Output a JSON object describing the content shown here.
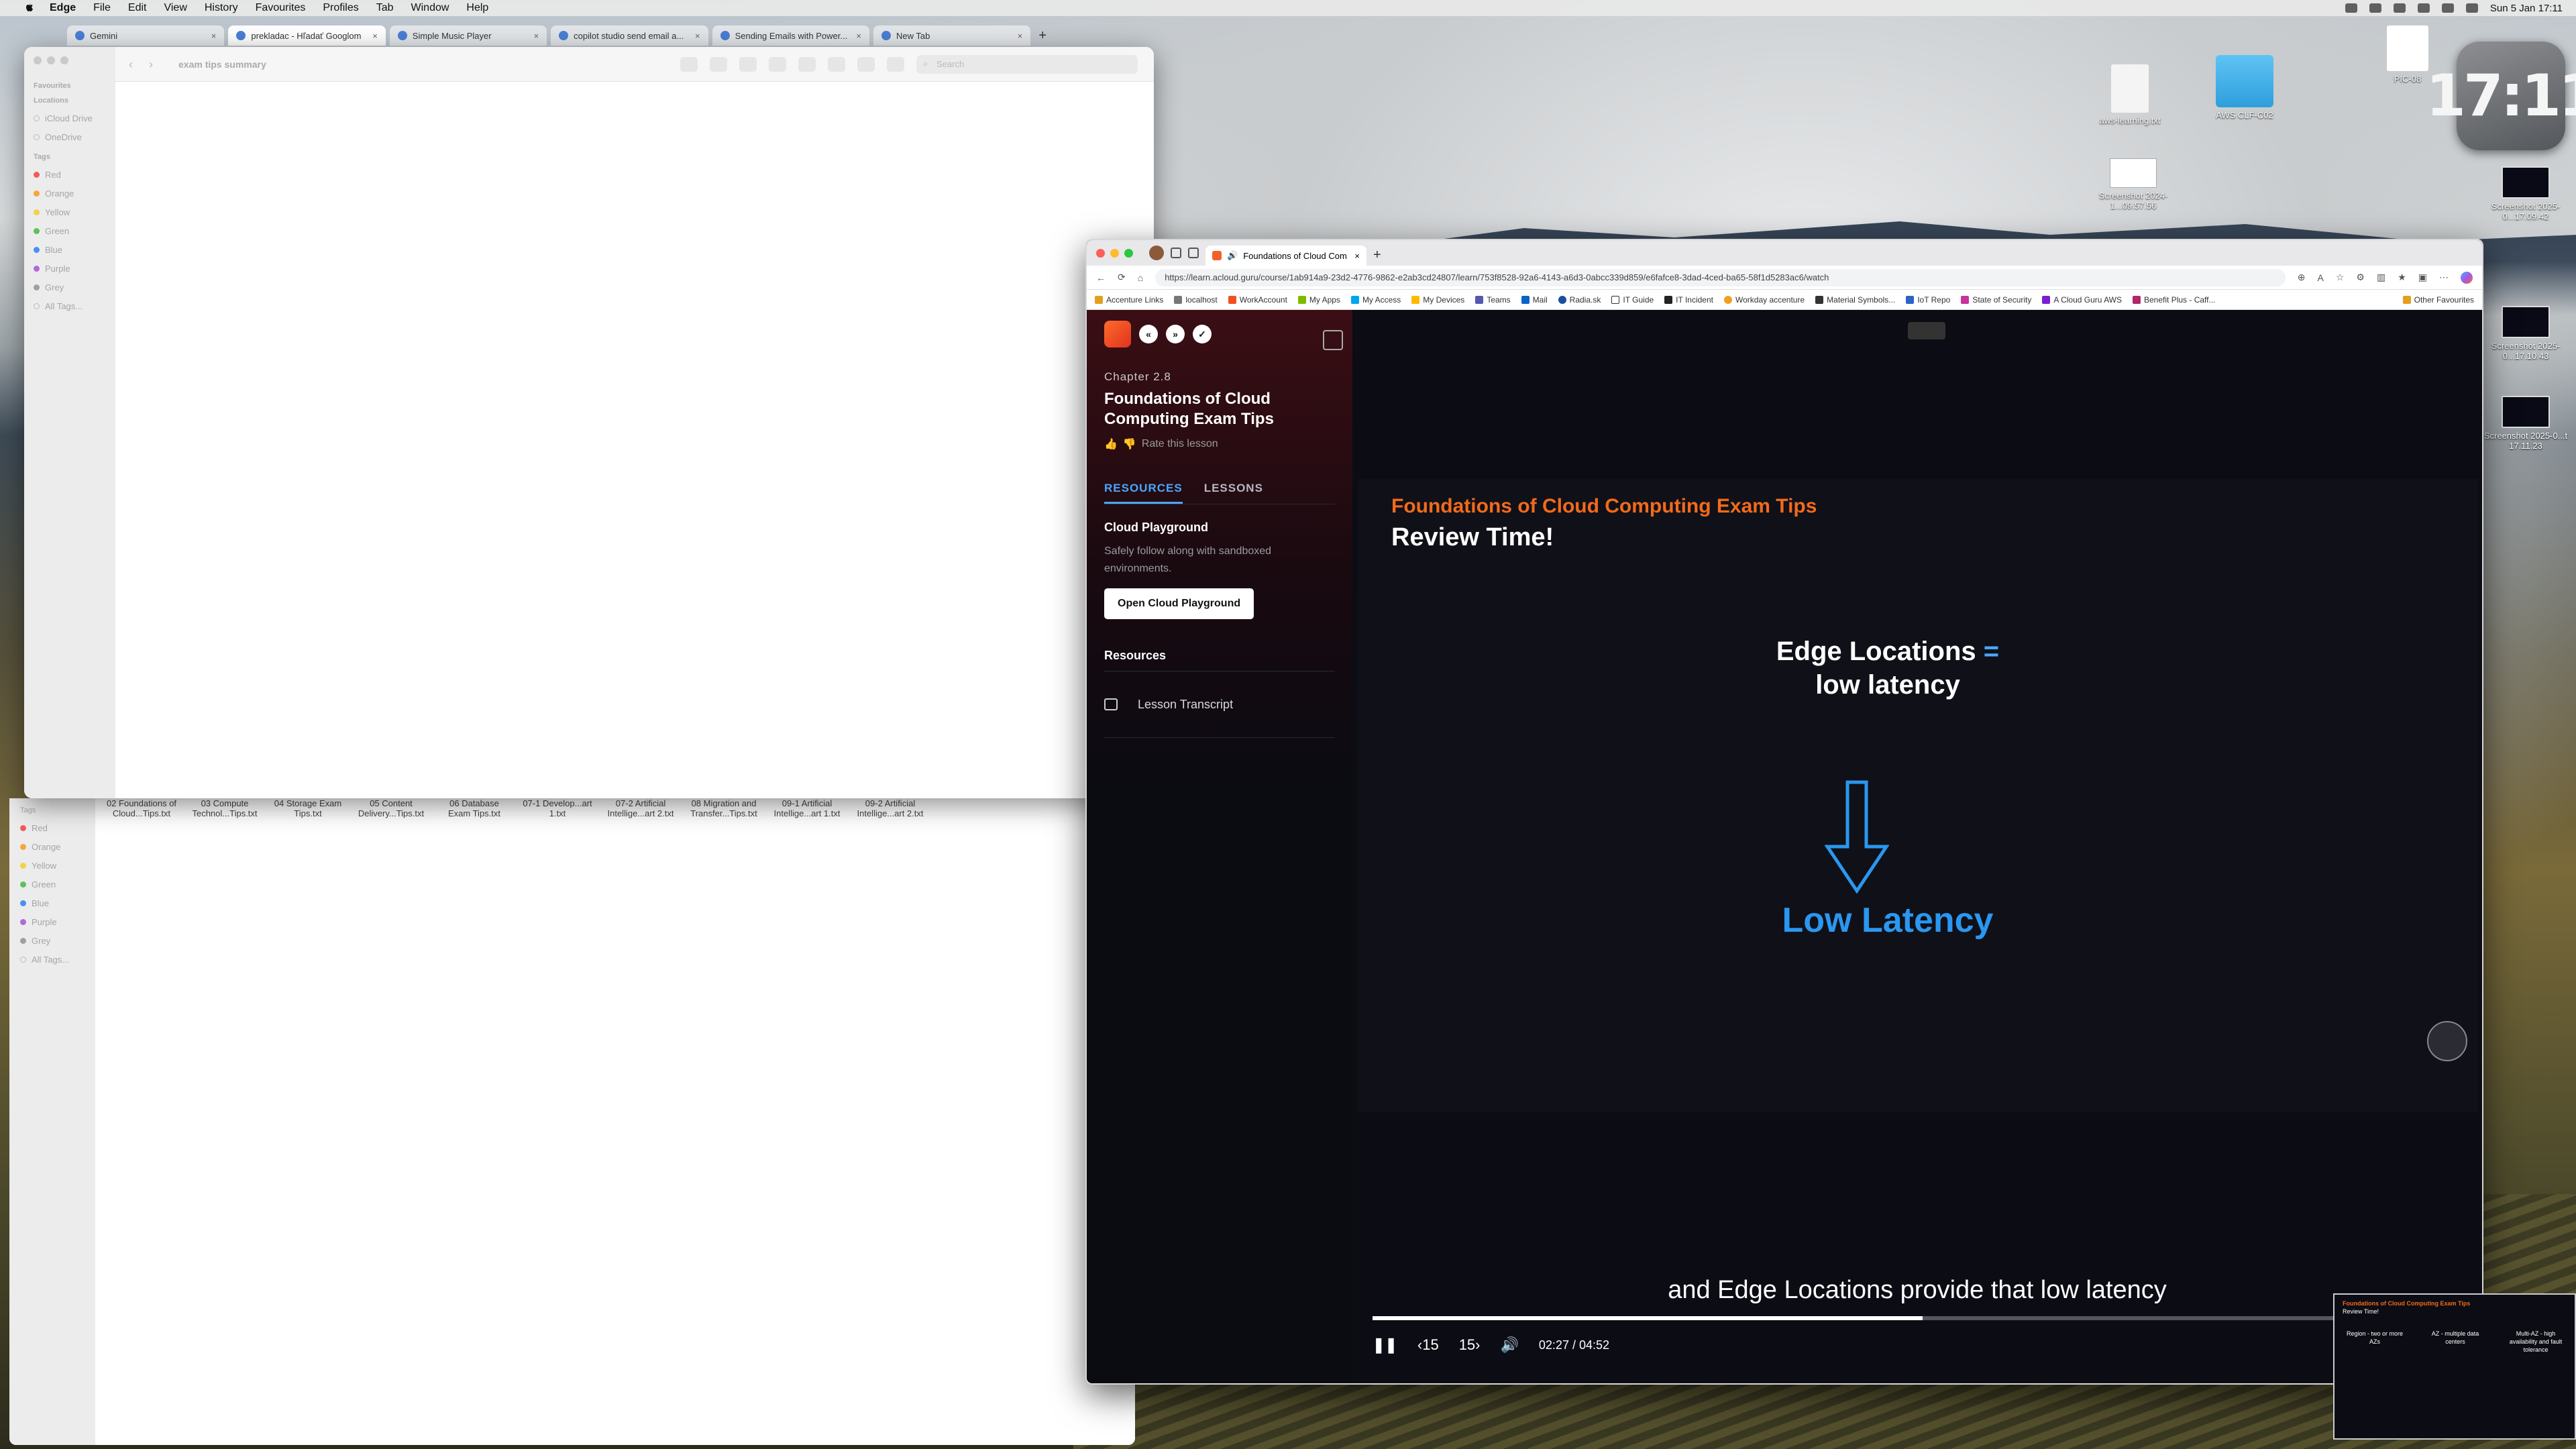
{
  "menubar": {
    "app": "Edge",
    "items": [
      "File",
      "Edit",
      "View",
      "History",
      "Favourites",
      "Profiles",
      "Tab",
      "Window",
      "Help"
    ],
    "clock": "Sun 5 Jan  17:11"
  },
  "desktop": {
    "clock_widget": "17:11",
    "icons": [
      {
        "label": "aws-learning.txt"
      },
      {
        "label": "AWS CLF-C02"
      },
      {
        "label": "PIC-08"
      },
      {
        "label": "Screenshot 2024-1...09.57.56"
      },
      {
        "label": "Screenshot 2025-0...17.09.42"
      },
      {
        "label": "Screenshot 2025-0...17.10.43"
      },
      {
        "label": "Screenshot 2025-0...t 17.11.23"
      }
    ]
  },
  "chrome_tabs": [
    {
      "label": "Gemini",
      "active": false
    },
    {
      "label": "prekladac - Hľadať Googlom",
      "active": true
    },
    {
      "label": "Simple Music Player",
      "active": false
    },
    {
      "label": "copilot studio send email a...",
      "active": false
    },
    {
      "label": "Sending Emails with Power...",
      "active": false
    },
    {
      "label": "New Tab",
      "active": false
    }
  ],
  "finder": {
    "title": "exam tips summary",
    "search_placeholder": "Search",
    "sidebar": {
      "favourites_header": "Favourites",
      "locations_header": "Locations",
      "locations": [
        "iCloud Drive",
        "OneDrive"
      ],
      "tags_header": "Tags",
      "tags": [
        {
          "name": "Red",
          "color": "#f45b5b"
        },
        {
          "name": "Orange",
          "color": "#f5a73a"
        },
        {
          "name": "Yellow",
          "color": "#f2d34a"
        },
        {
          "name": "Green",
          "color": "#5cc15e"
        },
        {
          "name": "Blue",
          "color": "#4a8ff0"
        },
        {
          "name": "Purple",
          "color": "#b06ad8"
        },
        {
          "name": "Grey",
          "color": "#a0a0a0"
        },
        {
          "name": "All Tags...",
          "color": ""
        }
      ]
    }
  },
  "finder2": {
    "tags_header": "Tags",
    "tags": [
      {
        "name": "Red",
        "color": "#f45b5b"
      },
      {
        "name": "Orange",
        "color": "#f5a73a"
      },
      {
        "name": "Yellow",
        "color": "#f2d34a"
      },
      {
        "name": "Green",
        "color": "#5cc15e"
      },
      {
        "name": "Blue",
        "color": "#4a8ff0"
      },
      {
        "name": "Purple",
        "color": "#b06ad8"
      },
      {
        "name": "Grey",
        "color": "#a0a0a0"
      },
      {
        "name": "All Tags...",
        "color": ""
      }
    ],
    "files": [
      "02 Foundations of Cloud...Tips.txt",
      "03 Compute Technol...Tips.txt",
      "04 Storage Exam Tips.txt",
      "05 Content Delivery...Tips.txt",
      "06 Database Exam Tips.txt",
      "07-1 Develop...art 1.txt",
      "07-2 Artificial Intellige...art 2.txt",
      "08 Migration and Transfer...Tips.txt",
      "09-1 Artificial Intellige...art 1.txt",
      "09-2 Artificial Intellige...art 2.txt"
    ]
  },
  "edge": {
    "tab_label": "Foundations of Cloud Com",
    "url": "https://learn.acloud.guru/course/1ab914a9-23d2-4776-9862-e2ab3cd24807/learn/753f8528-92a6-4143-a6d3-0abcc339d859/e6fafce8-3dad-4ced-ba65-58f1d5283ac6/watch",
    "bookmarks": [
      "Accenture Links",
      "localhost",
      "WorkAccount",
      "My Apps",
      "My Access",
      "My Devices",
      "Teams",
      "Mail",
      "Radia.sk",
      "IT Guide",
      "IT Incident",
      "Workday accenture",
      "Material Symbols...",
      "IoT Repo",
      "State of Security",
      "A Cloud Guru AWS",
      "Benefit Plus - Caff..."
    ],
    "bookmarks_other": "Other Favourites"
  },
  "course": {
    "chapter": "Chapter 2.8",
    "title": "Foundations of Cloud Computing Exam Tips",
    "rate": "Rate this lesson",
    "tab_resources": "RESOURCES",
    "tab_lessons": "LESSONS",
    "playground_header": "Cloud Playground",
    "playground_desc": "Safely follow along with sandboxed environments.",
    "playground_button": "Open Cloud Playground",
    "resources_header": "Resources",
    "resource_item": "Lesson Transcript"
  },
  "slide": {
    "kicker": "Foundations of Cloud Computing Exam Tips",
    "title": "Review Time!",
    "edge_line1": "Edge Locations",
    "edge_eq": "=",
    "edge_line2": "low latency",
    "low_latency": "Low Latency"
  },
  "player": {
    "caption": "and Edge Locations provide that low latency",
    "rewind": "15",
    "forward": "15",
    "time": "02:27 / 04:52",
    "progress": 0.505
  },
  "pip": {
    "kicker": "Foundations of Cloud Computing Exam Tips",
    "title": "Review Time!",
    "col1": "Region - two or more AZs",
    "col2": "AZ - multiple data centers",
    "col3": "Multi-AZ - high availability and fault tolerance"
  }
}
